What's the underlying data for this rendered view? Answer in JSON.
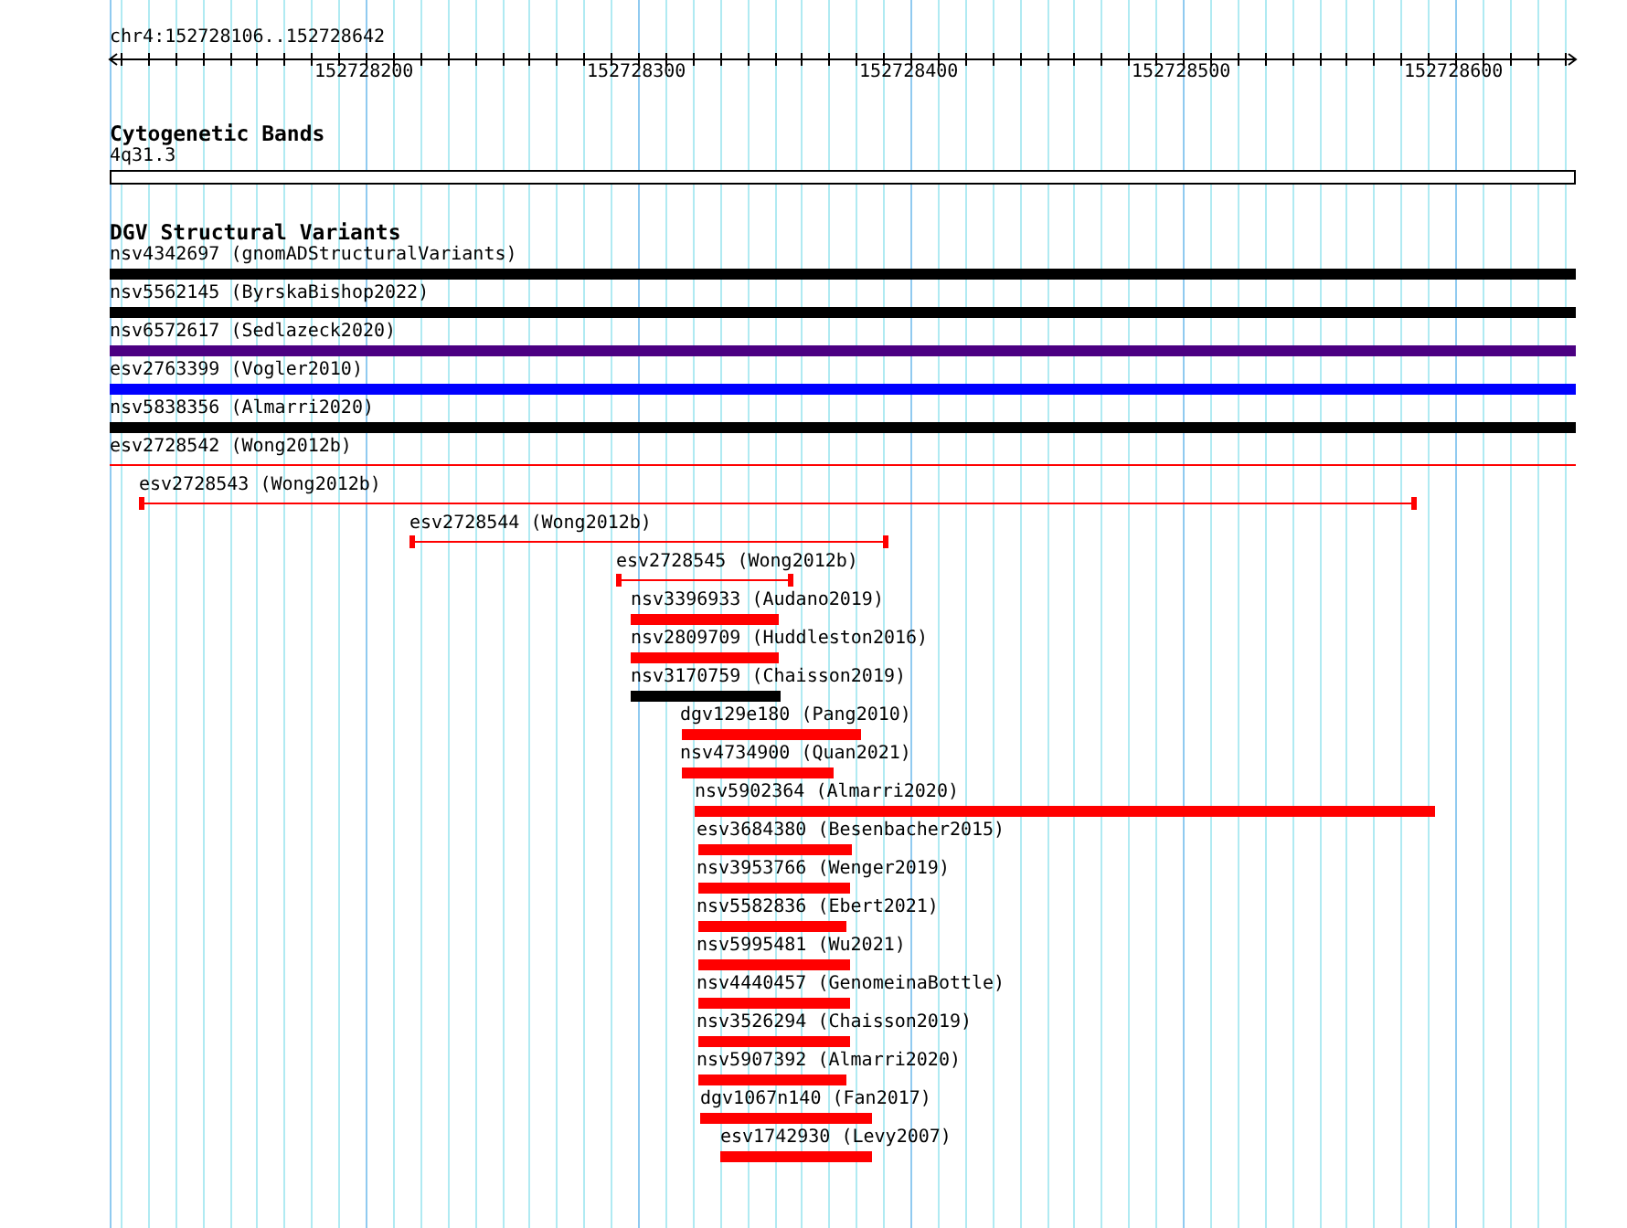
{
  "ruler": {
    "location": "chr4:152728106..152728642",
    "tick_labels": [
      "152728200",
      "152728300",
      "152728400",
      "152728500",
      "152728600"
    ]
  },
  "tracks": [
    {
      "title": "Cytogenetic Bands",
      "features": [
        {
          "label": "4q31.3",
          "kind": "band"
        }
      ]
    },
    {
      "title": "DGV Structural Variants",
      "features": [
        {
          "label": "nsv4342697 (gnomADStructuralVariants)",
          "kind": "bar",
          "color": "#000000"
        },
        {
          "label": "nsv5562145 (ByrskaBishop2022)",
          "kind": "bar",
          "color": "#000000"
        },
        {
          "label": "nsv6572617 (Sedlazeck2020)",
          "kind": "bar",
          "color": "#4b0082"
        },
        {
          "label": "esv2763399 (Vogler2010)",
          "kind": "bar",
          "color": "#0000ff"
        },
        {
          "label": "nsv5838356 (Almarri2020)",
          "kind": "bar",
          "color": "#000000"
        },
        {
          "label": "esv2728542 (Wong2012b)",
          "kind": "line",
          "color": "#ff0000"
        },
        {
          "label": "esv2728543 (Wong2012b)",
          "kind": "span",
          "color": "#ff0000"
        },
        {
          "label": "esv2728544 (Wong2012b)",
          "kind": "span",
          "color": "#ff0000"
        },
        {
          "label": "esv2728545 (Wong2012b)",
          "kind": "span",
          "color": "#ff0000"
        },
        {
          "label": "nsv3396933 (Audano2019)",
          "kind": "bar",
          "color": "#ff0000"
        },
        {
          "label": "nsv2809709 (Huddleston2016)",
          "kind": "bar",
          "color": "#ff0000"
        },
        {
          "label": "nsv3170759 (Chaisson2019)",
          "kind": "bar",
          "color": "#000000"
        },
        {
          "label": "dgv129e180 (Pang2010)",
          "kind": "bar",
          "color": "#ff0000"
        },
        {
          "label": "nsv4734900 (Quan2021)",
          "kind": "bar",
          "color": "#ff0000"
        },
        {
          "label": "nsv5902364 (Almarri2020)",
          "kind": "bar",
          "color": "#ff0000"
        },
        {
          "label": "esv3684380 (Besenbacher2015)",
          "kind": "bar",
          "color": "#ff0000"
        },
        {
          "label": "nsv3953766 (Wenger2019)",
          "kind": "bar",
          "color": "#ff0000"
        },
        {
          "label": "nsv5582836 (Ebert2021)",
          "kind": "bar",
          "color": "#ff0000"
        },
        {
          "label": "nsv5995481 (Wu2021)",
          "kind": "bar",
          "color": "#ff0000"
        },
        {
          "label": "nsv4440457 (GenomeinaBottle)",
          "kind": "bar",
          "color": "#ff0000"
        },
        {
          "label": "nsv3526294 (Chaisson2019)",
          "kind": "bar",
          "color": "#ff0000"
        },
        {
          "label": "nsv5907392 (Almarri2020)",
          "kind": "bar",
          "color": "#ff0000"
        },
        {
          "label": "dgv1067n140 (Fan2017)",
          "kind": "bar",
          "color": "#ff0000"
        },
        {
          "label": "esv1742930 (Levy2007)",
          "kind": "bar",
          "color": "#ff0000"
        }
      ]
    }
  ]
}
